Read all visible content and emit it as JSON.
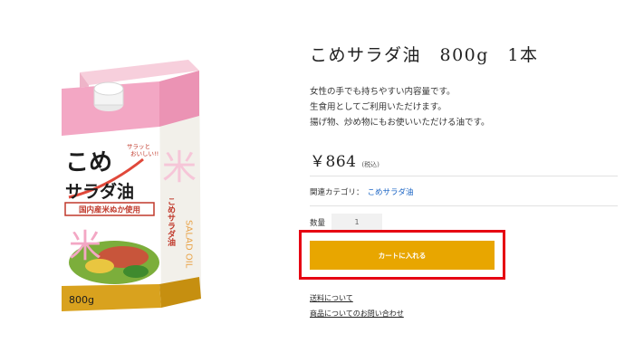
{
  "product": {
    "title": "こめサラダ油　800g　1本",
    "description": [
      "女性の手でも持ちやすい内容量です。",
      "生食用としてご利用いただけます。",
      "揚げ物、炒め物にもお使いいただける油です。"
    ],
    "price": "￥864",
    "tax_note": "(税込)",
    "category_label": "関連カテゴリ：",
    "category_link": "こめサラダ油",
    "quantity_label": "数量",
    "quantity_value": "1",
    "cart_button_label": "カートに入れる",
    "links": [
      "送料について",
      "商品についてのお問い合わせ"
    ],
    "image_icon": "oil-carton-image"
  },
  "package": {
    "name_line1": "こめ",
    "name_line2": "サラダ油",
    "tagline_line1": "サラッと",
    "tagline_line2": "おいしい!!",
    "origin_banner": "国内産米ぬか使用",
    "kanji": "米",
    "side_text": "SALAD OIL",
    "side_name": "こめサラダ油",
    "volume": "800g"
  },
  "colors": {
    "accent": "#e8a600",
    "highlight": "#e60012",
    "link": "#1a64c4",
    "package_pink": "#f3a7c4",
    "package_gold": "#d9a21e"
  }
}
